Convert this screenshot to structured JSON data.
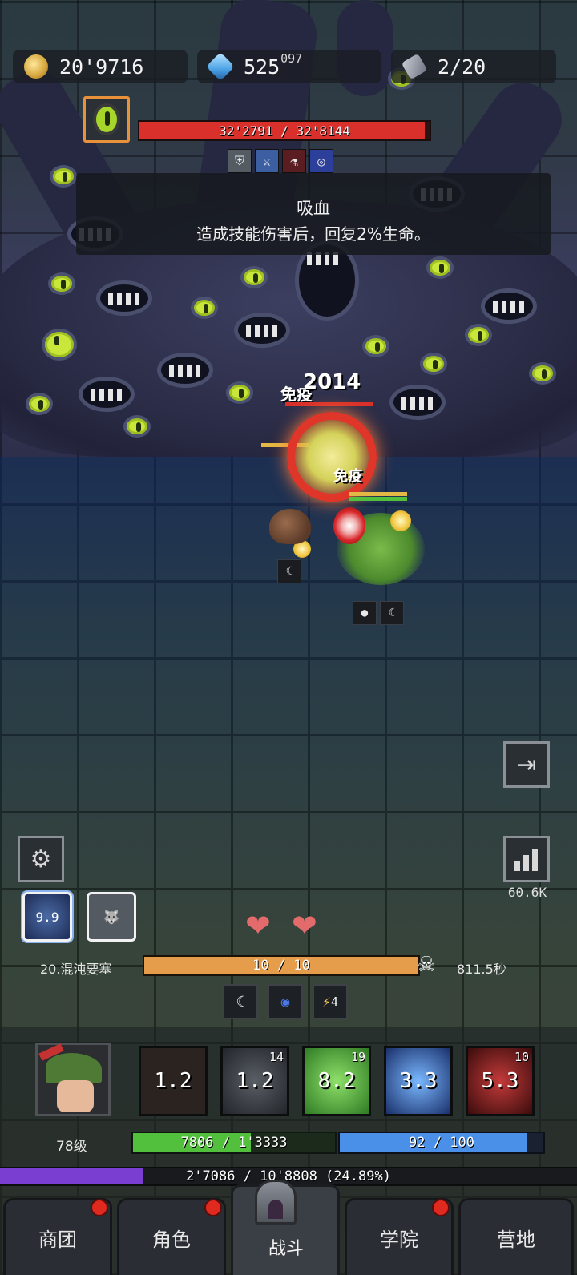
{
  "resources": {
    "gold": "20'9716",
    "gems": "525",
    "gems_sup": "097",
    "keys": "2/20",
    "gold_icon": "gold-coin-icon",
    "gem_icon": "blue-gem-icon",
    "key_icon": "stone-key-icon"
  },
  "boss": {
    "hp_text": "32'2791 / 32'8144",
    "hp_fraction": 0.9837,
    "skills": [
      "shield-icon",
      "sword-icon",
      "potion-icon",
      "vortex-icon"
    ]
  },
  "tooltip": {
    "title": "吸血",
    "description": "造成技能伤害后，回复2%生命。"
  },
  "combat": {
    "float_text_1": "免疫",
    "float_text_2": "免疫",
    "float_number": "2014",
    "pet_slot_icon": "claw-icon",
    "hero_slots": [
      "black-hole-icon",
      "claw-icon"
    ]
  },
  "side": {
    "exit_icon": "exit-icon",
    "settings_icon": "gear-icon",
    "stats_icon": "bar-chart-icon",
    "dps": "60.6K"
  },
  "stage": {
    "slot1_value": "9.9",
    "stage_name": "20.混沌要塞",
    "wave_text": "10 / 10",
    "wave_fraction": 1.0,
    "time_left": "811.5秒",
    "hearts": 2,
    "buffs": [
      {
        "icon": "claw-icon",
        "label": ""
      },
      {
        "icon": "black-hole-icon",
        "label": ""
      },
      {
        "icon": "lightning-icon",
        "label": "4"
      }
    ]
  },
  "hero": {
    "level": "78级",
    "hp_text": "7806 / 1'3333",
    "hp_fraction": 0.585,
    "mp_text": "92 / 100",
    "mp_fraction": 0.92,
    "xp_text": "2'7086 / 10'8808 (24.89%)",
    "xp_fraction": 0.2489,
    "skills": [
      {
        "value": "1.2",
        "badge": "",
        "color": "#2a2320"
      },
      {
        "value": "1.2",
        "badge": "14",
        "color": "#2c2f33"
      },
      {
        "value": "8.2",
        "badge": "19",
        "color": "#3a8a2e"
      },
      {
        "value": "3.3",
        "badge": "",
        "color": "#2a3a6a"
      },
      {
        "value": "5.3",
        "badge": "10",
        "color": "#6a1e1e"
      }
    ]
  },
  "nav": {
    "tabs": [
      "商团",
      "角色",
      "战斗",
      "学院",
      "营地"
    ],
    "active": "战斗"
  },
  "colors": {
    "boss_hp": "#d9302b",
    "wave": "#e59d4c",
    "hp": "#52c03c",
    "mp": "#4a90e8",
    "xp": "#7a3fd0",
    "notification": "#e0291f"
  }
}
